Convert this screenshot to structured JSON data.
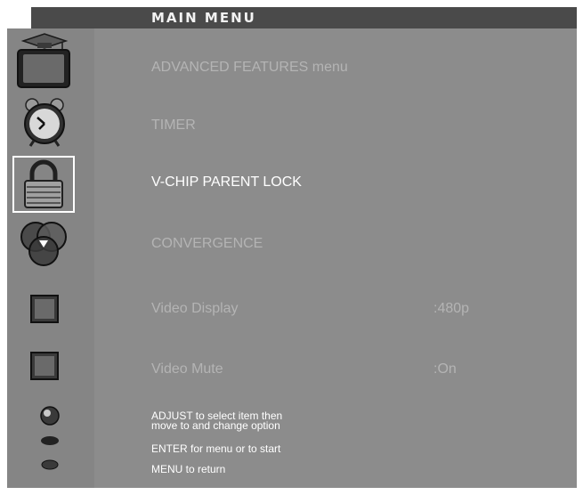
{
  "menu_title": "MAIN MENU",
  "items": [
    {
      "label": "ADVANCED FEATURES menu",
      "icon": "tv-graduation-cap-icon",
      "value": ""
    },
    {
      "label": "TIMER",
      "icon": "alarm-clock-icon",
      "value": ""
    },
    {
      "label": "V-CHIP PARENT LOCK",
      "icon": "padlock-icon",
      "value": ""
    },
    {
      "label": "CONVERGENCE",
      "icon": "convergence-circles-icon",
      "value": ""
    },
    {
      "label": "Video Display",
      "icon": "square-icon",
      "value": ":480p"
    },
    {
      "label": "Video Mute",
      "icon": "square-icon",
      "value": ":On"
    }
  ],
  "selected_index": 2,
  "help": {
    "adjust_line1": "ADJUST to select item then",
    "adjust_line2": "move to and change option",
    "enter": "ENTER for menu or to start",
    "menu": "MENU to return"
  },
  "colors": {
    "panel": "#8c8c8c",
    "header": "#4a4a4a",
    "label_dim": "#b4b4b4",
    "label_active": "#ffffff"
  }
}
